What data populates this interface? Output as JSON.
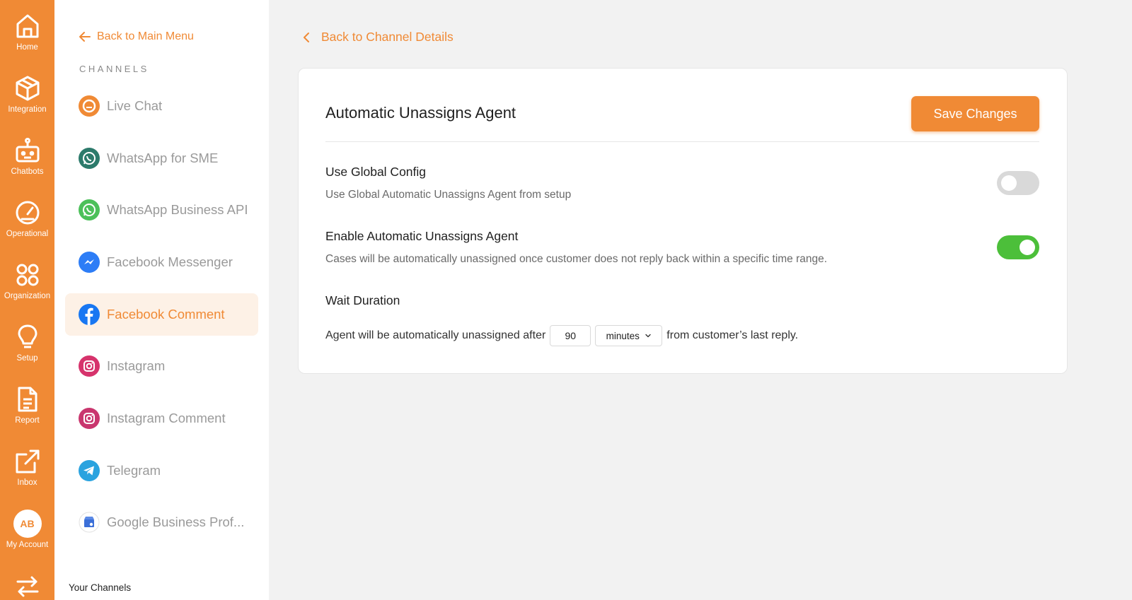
{
  "rail": {
    "items": [
      {
        "label": "Home",
        "icon": "home-icon"
      },
      {
        "label": "Integration",
        "icon": "cube-icon"
      },
      {
        "label": "Chatbots",
        "icon": "robot-icon"
      },
      {
        "label": "Operational",
        "icon": "gauge-icon"
      },
      {
        "label": "Organization",
        "icon": "four-circles-icon"
      },
      {
        "label": "Setup",
        "icon": "lightbulb-icon"
      },
      {
        "label": "Report",
        "icon": "document-icon"
      },
      {
        "label": "Inbox",
        "icon": "external-link-icon"
      },
      {
        "label": "My Account",
        "icon": "avatar",
        "initials": "AB"
      },
      {
        "label": "",
        "icon": "switch-arrows-icon"
      }
    ],
    "accent": "#f08a35"
  },
  "sidebar": {
    "back_label": "Back to Main Menu",
    "heading": "CHANNELS",
    "items": [
      {
        "label": "Live Chat",
        "icon": "live-chat-icon",
        "color": "#f08a35"
      },
      {
        "label": "WhatsApp for SME",
        "icon": "whatsapp-sme-icon",
        "color": "#2c7a6b"
      },
      {
        "label": "WhatsApp Business API",
        "icon": "whatsapp-icon",
        "color": "#4cc05a"
      },
      {
        "label": "Facebook Messenger",
        "icon": "messenger-icon",
        "color": "#2d7df6"
      },
      {
        "label": "Facebook Comment",
        "icon": "facebook-icon",
        "color": "#1877f2",
        "active": true
      },
      {
        "label": "Instagram",
        "icon": "instagram-icon",
        "color": "#d6336c"
      },
      {
        "label": "Instagram Comment",
        "icon": "instagram-comment-icon",
        "color": "#d6336c"
      },
      {
        "label": "Telegram",
        "icon": "telegram-icon",
        "color": "#2aa3df"
      },
      {
        "label": "Google Business Prof...",
        "icon": "google-business-icon",
        "color": "#3b6fd8"
      }
    ],
    "footer": "Your Channels"
  },
  "main": {
    "back_label": "Back to Channel Details",
    "card": {
      "title": "Automatic Unassigns Agent",
      "save_label": "Save Changes",
      "global_config": {
        "title": "Use Global Config",
        "desc": "Use Global Automatic Unassigns Agent from setup",
        "enabled": false
      },
      "enable_auto": {
        "title": "Enable Automatic Unassigns Agent",
        "desc": "Cases will be automatically unassigned once customer does not reply back within a specific time range.",
        "enabled": true
      },
      "wait": {
        "title": "Wait Duration",
        "prefix": "Agent will be automatically unassigned after",
        "value": "90",
        "unit": "minutes",
        "suffix": "from customer’s last reply."
      }
    }
  }
}
